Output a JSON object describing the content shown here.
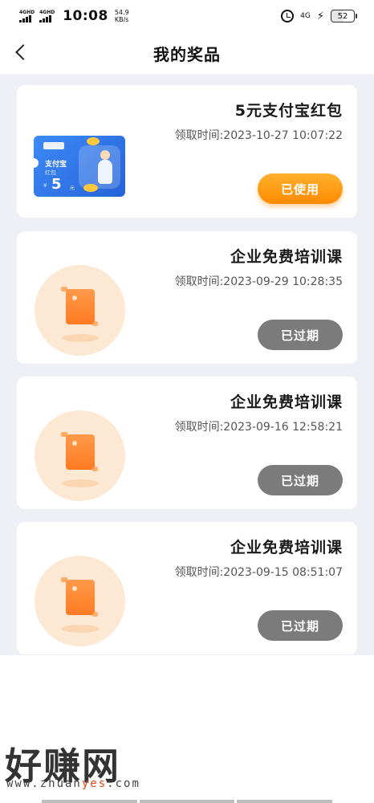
{
  "status_bar": {
    "sig1": "4GHD",
    "sig2": "4GHD",
    "time": "10:08",
    "speed_value": "54.9",
    "speed_unit": "KB/s",
    "net": "4G",
    "battery": "52"
  },
  "header": {
    "title": "我的奖品"
  },
  "prizes": [
    {
      "title": "5元支付宝红包",
      "time": "领取时间:2023-10-27 10:07:22",
      "button": "已使用",
      "voucher": {
        "name": "支付宝",
        "sub": "红包",
        "yen": "¥",
        "amount": "5",
        "unit": "元"
      }
    },
    {
      "title": "企业免费培训课",
      "time": "领取时间:2023-09-29 10:28:35",
      "button": "已过期"
    },
    {
      "title": "企业免费培训课",
      "time": "领取时间:2023-09-16 12:58:21",
      "button": "已过期"
    },
    {
      "title": "企业免费培训课",
      "time": "领取时间:2023-09-15 08:51:07",
      "button": "已过期"
    }
  ],
  "watermark": {
    "main": "好赚网",
    "url_a": "www.zhuan",
    "url_b": "yes",
    "url_c": ".com"
  },
  "colors": {
    "accent_orange": "#ff8a00",
    "expired_gray": "#7b7b7b",
    "list_bg": "#eef0f5"
  }
}
